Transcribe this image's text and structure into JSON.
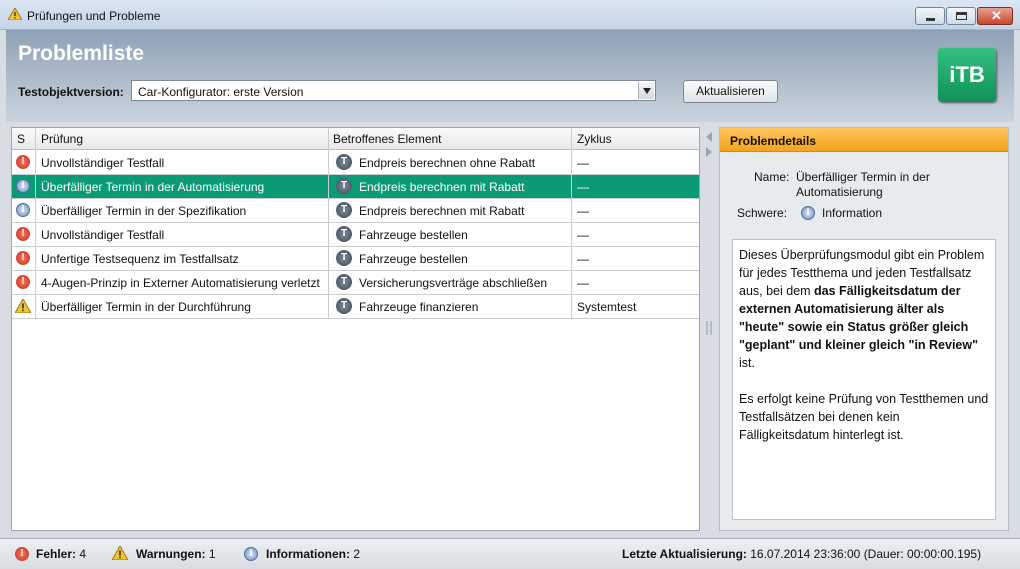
{
  "window": {
    "title": "Prüfungen und Probleme"
  },
  "header": {
    "title": "Problemliste",
    "version_label": "Testobjektversion:",
    "version_value": "Car-Konfigurator: erste Version",
    "refresh_button": "Aktualisieren",
    "logo_text": "iTB"
  },
  "table": {
    "columns": [
      "S",
      "Prüfung",
      "Betroffenes Element",
      "Zyklus"
    ],
    "rows": [
      {
        "severity": "error",
        "check": "Unvollständiger Testfall",
        "element": "Endpreis berechnen ohne Rabatt",
        "cycle": "—"
      },
      {
        "severity": "info",
        "check": "Überfälliger Termin in der Automatisierung",
        "element": "Endpreis berechnen mit Rabatt",
        "cycle": "—",
        "selected": true
      },
      {
        "severity": "info",
        "check": "Überfälliger Termin in der Spezifikation",
        "element": "Endpreis berechnen mit Rabatt",
        "cycle": "—"
      },
      {
        "severity": "error",
        "check": "Unvollständiger Testfall",
        "element": "Fahrzeuge bestellen",
        "cycle": "—"
      },
      {
        "severity": "error",
        "check": "Unfertige Testsequenz im Testfallsatz",
        "element": "Fahrzeuge bestellen",
        "cycle": "—"
      },
      {
        "severity": "error",
        "check": "4-Augen-Prinzip in Externer Automatisierung verletzt",
        "element": "Versicherungsverträge abschließen",
        "cycle": "—"
      },
      {
        "severity": "warning",
        "check": "Überfälliger Termin in der Durchführung",
        "element": "Fahrzeuge finanzieren",
        "cycle": "Systemtest"
      }
    ]
  },
  "details": {
    "title": "Problemdetails",
    "name_label": "Name:",
    "name_value_line1": "Überfälliger Termin in der",
    "name_value_line2": "Automatisierung",
    "severity_label": "Schwere:",
    "severity_value": "Information",
    "desc_p1_a": "Dieses Überprüfungsmodul gibt ein Problem für jedes Testthema und jeden Testfallsatz aus, bei dem ",
    "desc_p1_b": "das Fälligkeitsdatum der externen Automatisierung älter als \"heute\" sowie ein Status größer gleich \"geplant\" und kleiner gleich \"in Review\"",
    "desc_p1_c": " ist.",
    "desc_p2": "Es erfolgt keine Prüfung von Testthemen und Testfallsätzen bei denen kein Fälligkeitsdatum hinterlegt ist."
  },
  "status": {
    "errors_label": "Fehler:",
    "errors_count": "4",
    "warnings_label": "Warnungen:",
    "warnings_count": "1",
    "infos_label": "Informationen:",
    "infos_count": "2",
    "last_update_label": "Letzte Aktualisierung:",
    "last_update_value": "16.07.2014  23:36:00  (Dauer: 00:00:00.195)"
  },
  "colors": {
    "selected_row": "#0b9a76",
    "details_header": "#f5a21a",
    "logo": "#1aa566"
  }
}
